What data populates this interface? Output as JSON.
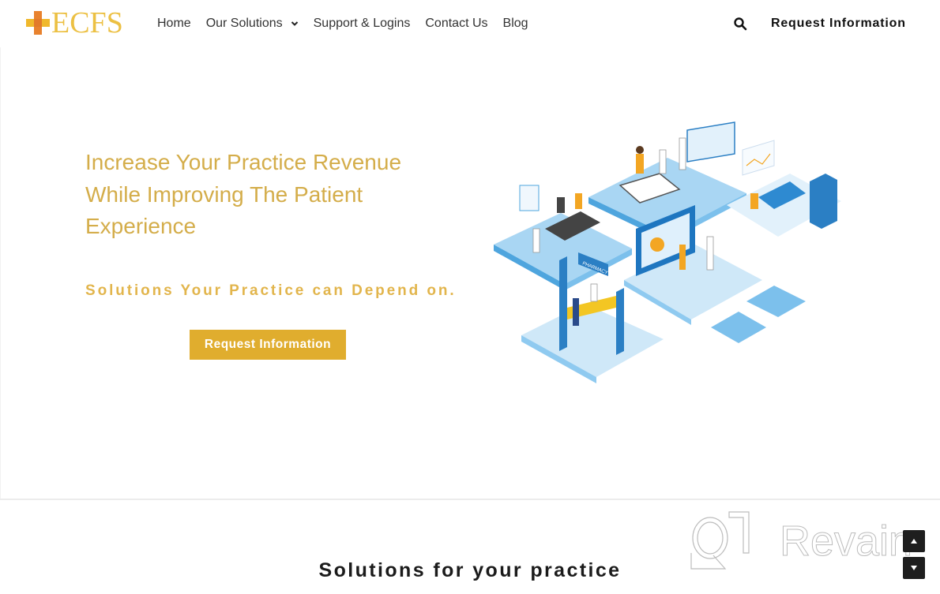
{
  "brand": {
    "logo_text": "ECFS",
    "colors": {
      "gold": "#d4ad4a",
      "button_gold": "#e0ad2e",
      "cross_orange": "#e8822e",
      "cross_yellow": "#f0b82c"
    }
  },
  "header": {
    "nav": [
      {
        "label": "Home",
        "icon": null
      },
      {
        "label": "Our Solutions",
        "icon": "chevron-down-icon"
      },
      {
        "label": "Support & Logins",
        "icon": null
      },
      {
        "label": "Contact Us",
        "icon": null
      },
      {
        "label": "Blog",
        "icon": null
      }
    ],
    "search_icon": "search-icon",
    "cta_label": "Request Information"
  },
  "hero": {
    "title": "Increase Your Practice Revenue While Improving The Patient Experience",
    "subtitle": "Solutions Your Practice can Depend on.",
    "button_label": "Request Information",
    "illustration_labels": {
      "pharmacy_sign": "PHARMACY"
    }
  },
  "solutions": {
    "title": "Solutions for your practice"
  },
  "watermark": {
    "text": "Revain"
  },
  "scroll_controls": {
    "up_icon": "arrow-up-icon",
    "down_icon": "arrow-down-icon"
  }
}
